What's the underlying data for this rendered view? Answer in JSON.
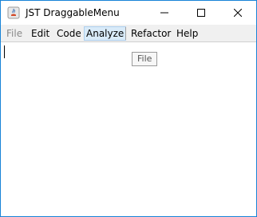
{
  "window": {
    "title": "JST DraggableMenu",
    "border_color": "#1883d7"
  },
  "titlebar_buttons": {
    "minimize_icon": "minimize-icon",
    "maximize_icon": "maximize-icon",
    "close_icon": "close-icon"
  },
  "menubar": {
    "items": [
      {
        "label": "File",
        "state": "disabled"
      },
      {
        "label": "Edit",
        "state": "normal"
      },
      {
        "label": "Code",
        "state": "normal"
      },
      {
        "label": "Analyze",
        "state": "hover"
      },
      {
        "label": "Refactor",
        "state": "normal"
      },
      {
        "label": "Help",
        "state": "normal"
      }
    ]
  },
  "drag_preview": {
    "label": "File"
  },
  "colors": {
    "menu_hover_bg": "#d9ebf9",
    "menu_hover_border": "#aecfed",
    "disabled_text": "#8a8a8a"
  }
}
